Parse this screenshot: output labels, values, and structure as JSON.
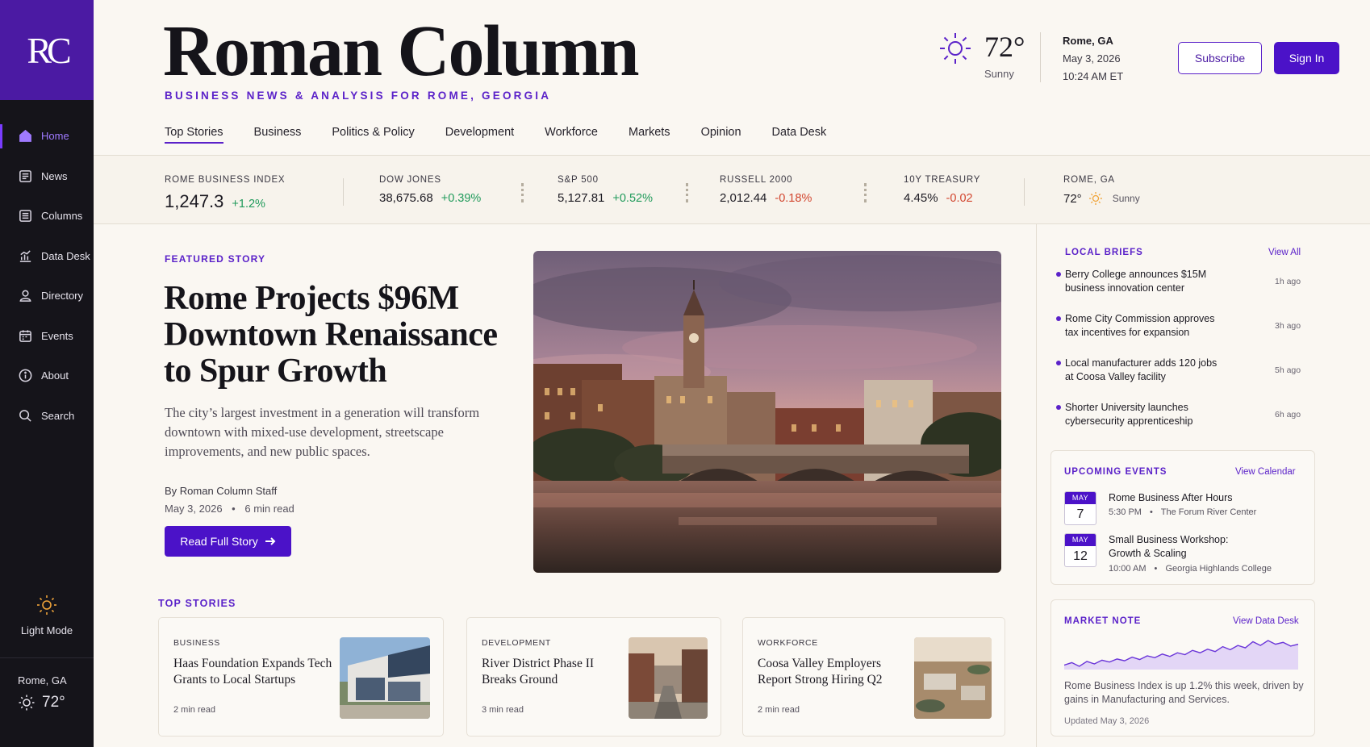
{
  "brand": {
    "logo_text": "RC",
    "name": "Roman Column",
    "tagline": "BUSINESS NEWS & ANALYSIS FOR ROME, GEORGIA"
  },
  "sidebar": {
    "items": [
      {
        "label": "Home",
        "icon": "home-icon"
      },
      {
        "label": "News",
        "icon": "newspaper-icon"
      },
      {
        "label": "Columns",
        "icon": "columns-icon"
      },
      {
        "label": "Data Desk",
        "icon": "chart-icon"
      },
      {
        "label": "Directory",
        "icon": "person-icon"
      },
      {
        "label": "Events",
        "icon": "calendar-icon"
      },
      {
        "label": "About",
        "icon": "info-icon"
      },
      {
        "label": "Search",
        "icon": "search-icon"
      }
    ],
    "mode_label": "Light Mode",
    "weather_location": "Rome, GA",
    "weather_temp": "72°"
  },
  "header": {
    "weather_temp": "72°",
    "weather_condition": "Sunny",
    "location": "Rome, GA",
    "date": "May 3, 2026",
    "time": "10:24 AM ET",
    "subscribe_label": "Subscribe",
    "signin_label": "Sign In"
  },
  "tabs": [
    "Top Stories",
    "Business",
    "Politics & Policy",
    "Development",
    "Workforce",
    "Markets",
    "Opinion",
    "Data Desk"
  ],
  "ticker": {
    "index": {
      "label": "ROME BUSINESS INDEX",
      "value": "1,247.3",
      "change": "+1.2%"
    },
    "dow": {
      "label": "DOW JONES",
      "value": "38,675.68",
      "change": "+0.39%"
    },
    "sp": {
      "label": "S&P 500",
      "value": "5,127.81",
      "change": "+0.52%"
    },
    "russell": {
      "label": "RUSSELL 2000",
      "value": "2,012.44",
      "change": "-0.18%"
    },
    "treasury": {
      "label": "10Y TREASURY",
      "value": "4.45%",
      "change": "-0.02"
    },
    "local": {
      "label": "ROME, GA",
      "value": "72°",
      "condition": "Sunny"
    }
  },
  "featured": {
    "label": "FEATURED STORY",
    "title": "Rome Projects $96M Downtown Renaissance to Spur Growth",
    "dek": "The city’s largest investment in a generation will transform downtown with mixed-use development, streetscape improvements, and new public spaces.",
    "byline": "By Roman Column Staff",
    "date": "May 3, 2026",
    "read_time": "6 min read",
    "cta": "Read Full Story"
  },
  "top_stories": {
    "label": "TOP STORIES",
    "cards": [
      {
        "category": "BUSINESS",
        "headline": "Haas Foundation Expands Tech Grants to Local Startups",
        "read_time": "2 min read"
      },
      {
        "category": "DEVELOPMENT",
        "headline": "River District Phase II Breaks Ground",
        "read_time": "3 min read"
      },
      {
        "category": "WORKFORCE",
        "headline": "Coosa Valley Employers Report Strong Hiring Q2",
        "read_time": "2 min read"
      }
    ]
  },
  "briefs": {
    "label": "LOCAL BRIEFS",
    "link": "View All",
    "items": [
      {
        "text": "Berry College announces $15M business innovation center",
        "ago": "1h ago"
      },
      {
        "text": "Rome City Commission approves tax incentives for expansion",
        "ago": "3h ago"
      },
      {
        "text": "Local manufacturer adds 120 jobs at Coosa Valley facility",
        "ago": "5h ago"
      },
      {
        "text": "Shorter University launches cybersecurity apprenticeship",
        "ago": "6h ago"
      }
    ]
  },
  "events": {
    "label": "UPCOMING EVENTS",
    "link": "View Calendar",
    "items": [
      {
        "month": "MAY",
        "day": "7",
        "title": "Rome Business After Hours",
        "time": "5:30 PM",
        "venue": "The Forum River Center"
      },
      {
        "month": "MAY",
        "day": "12",
        "title": "Small Business Workshop: Growth & Scaling",
        "time": "10:00 AM",
        "venue": "Georgia Highlands College"
      }
    ]
  },
  "market_note": {
    "label": "MARKET NOTE",
    "link": "View Data Desk",
    "text": "Rome Business Index is up 1.2% this week, driven by gains in Manufacturing and Services.",
    "updated": "Updated May 3, 2026",
    "sparkline": [
      40,
      44,
      38,
      46,
      42,
      48,
      45,
      50,
      47,
      53,
      49,
      55,
      52,
      58,
      54,
      60,
      57,
      64,
      60,
      66,
      62,
      70,
      65,
      72,
      68,
      78,
      72,
      80,
      74,
      77,
      71,
      74
    ]
  },
  "colors": {
    "accent": "#5b22c9",
    "sidebar": "#15141a",
    "logo_bg": "#4b1aa3",
    "up": "#1f9a5a",
    "down": "#d2452e"
  }
}
